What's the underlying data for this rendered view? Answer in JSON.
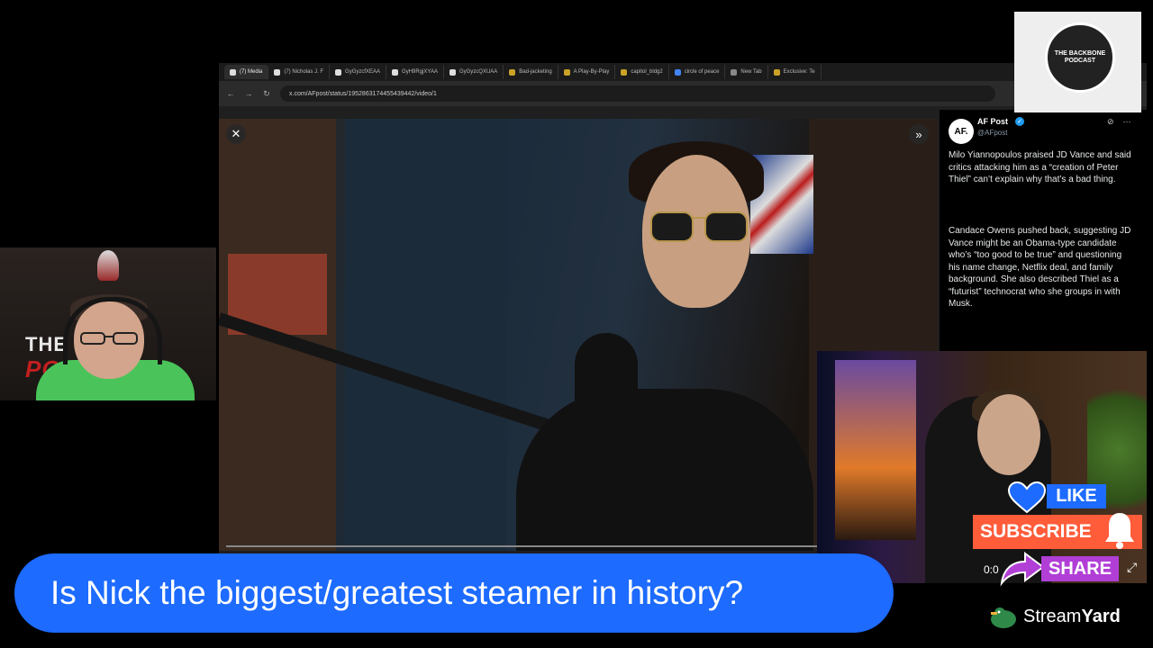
{
  "browser": {
    "tabs": [
      {
        "label": "(7) Media",
        "icon": "x-icon",
        "active": true
      },
      {
        "label": "(7) Nicholas J. F",
        "icon": "x-icon"
      },
      {
        "label": "GyGyzcfXEAA",
        "icon": "x-icon"
      },
      {
        "label": "GyH9RgjXYAA",
        "icon": "x-icon"
      },
      {
        "label": "GyGyzcQXUAA",
        "icon": "x-icon"
      },
      {
        "label": "Bad-jacketing",
        "icon": "page-icon"
      },
      {
        "label": "A Play-By-Play",
        "icon": "page-icon"
      },
      {
        "label": "capitol_bldg2",
        "icon": "page-icon"
      },
      {
        "label": "circle of peace",
        "icon": "google-icon"
      },
      {
        "label": "New Tab",
        "icon": "globe-icon"
      },
      {
        "label": "Exclusive: Te",
        "icon": "page-icon"
      }
    ],
    "url": "x.com/AFpost/status/1952863174455439442/video/1",
    "close_glyph": "✕",
    "expand_glyph": "»"
  },
  "tweet": {
    "avatar_text": "AF.",
    "name": "AF Post",
    "handle": "@AFpost",
    "paragraph1": "Milo Yiannopoulos praised JD Vance and said critics attacking him as a “creation of Peter Thiel” can’t explain why that’s a bad thing.",
    "paragraph2": "Candace Owens pushed back, suggesting JD Vance might be an Obama-type candidate who’s “too good to be true” and questioning his name change, Netflix deal, and family background. She also described Thiel as a “futurist” technocrat who she groups in with Musk."
  },
  "inset": {
    "time": "0:0"
  },
  "logo": {
    "text": "THE BACKBONE PODCAST"
  },
  "host": {
    "bg_line1": "THE    ONE",
    "bg_line2": "PO    AST"
  },
  "banner": {
    "text": "Is Nick the biggest/greatest steamer in history?"
  },
  "cta": {
    "like": "LIKE",
    "subscribe": "SUBSCRIBE",
    "share": "SHARE"
  },
  "branding": {
    "name_regular": "Stream",
    "name_bold": "Yard"
  },
  "colors": {
    "banner": "#1d6bff",
    "subscribe": "#ff5c3a",
    "share": "#b13fd6",
    "like": "#1d6bff",
    "verified": "#1d9bf0"
  }
}
